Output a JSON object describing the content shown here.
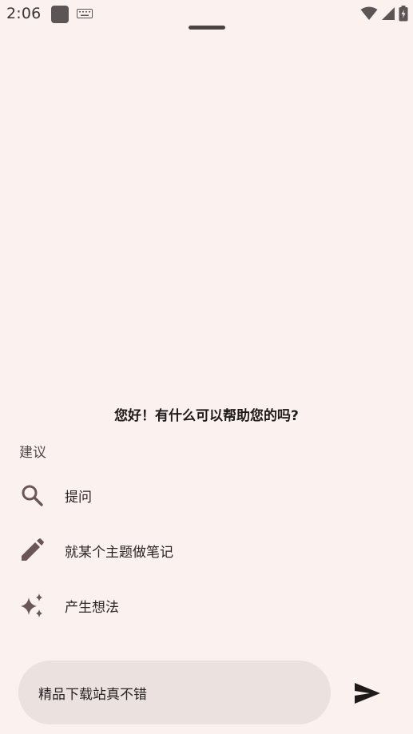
{
  "status_bar": {
    "time": "2:06",
    "icons": [
      "app-icon",
      "keyboard-icon",
      "wifi-icon",
      "signal-icon",
      "battery-charging-icon"
    ]
  },
  "assistant": {
    "greeting": "您好！有什么可以帮助您的吗?",
    "suggestions_label": "建议",
    "suggestions": [
      {
        "icon": "search-icon",
        "label": "提问"
      },
      {
        "icon": "pencil-icon",
        "label": "就某个主题做笔记"
      },
      {
        "icon": "sparkle-icon",
        "label": "产生想法"
      }
    ]
  },
  "input": {
    "value": "精品下载站真不错",
    "send_icon": "send-icon"
  },
  "colors": {
    "background": "#fbf2f0",
    "input_background": "#ebe2e0",
    "icon": "#6b5656",
    "text": "#1f1a1a"
  }
}
